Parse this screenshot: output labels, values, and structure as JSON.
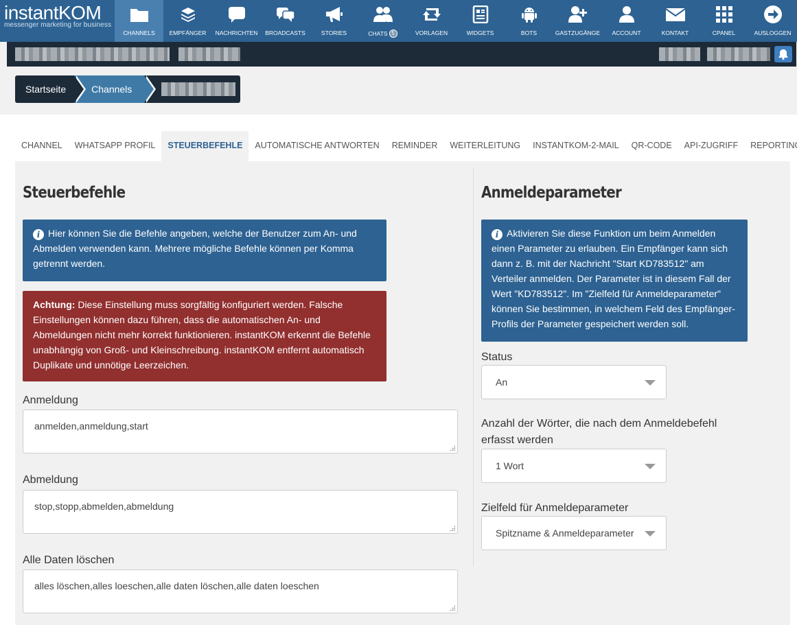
{
  "brand": {
    "name_left": "instant",
    "name_right": "KOM",
    "tagline": "messenger marketing for business"
  },
  "nav": [
    {
      "label": "CHANNELS",
      "icon": "folder-icon",
      "active": true
    },
    {
      "label": "EMPFÄNGER",
      "icon": "layers-icon"
    },
    {
      "label": "NACHRICHTEN",
      "icon": "speech-bubble-icon"
    },
    {
      "label": "BROADCASTS",
      "icon": "chat-bubbles-icon"
    },
    {
      "label": "STORIES",
      "icon": "megaphone-icon"
    },
    {
      "label": "CHATS",
      "icon": "users-icon",
      "badge": "5"
    },
    {
      "label": "VORLAGEN",
      "icon": "retweet-icon"
    },
    {
      "label": "WIDGETS",
      "icon": "newspaper-icon"
    },
    {
      "label": "BOTS",
      "icon": "android-icon"
    },
    {
      "label": "GASTZUGÄNGE",
      "icon": "user-plus-icon"
    },
    {
      "label": "ACCOUNT",
      "icon": "user-icon"
    },
    {
      "label": "KONTAKT",
      "icon": "envelope-icon"
    },
    {
      "label": "CPANEL",
      "icon": "grid-icon"
    },
    {
      "label": "AUSLOGGEN",
      "icon": "arrow-circle-right-icon"
    }
  ],
  "breadcrumb": {
    "home": "Startseite",
    "channels": "Channels"
  },
  "tabs": [
    "CHANNEL",
    "WHATSAPP PROFIL",
    "STEUERBEFEHLE",
    "AUTOMATISCHE ANTWORTEN",
    "REMINDER",
    "WEITERLEITUNG",
    "INSTANTKOM-2-MAIL",
    "QR-CODE",
    "API-ZUGRIFF",
    "REPORTING"
  ],
  "left": {
    "title": "Steuerbefehle",
    "info": "Hier können Sie die Befehle angeben, welche der Benutzer zum An- und Abmelden verwenden kann. Mehrere mögliche Befehle können per Komma getrennt werden.",
    "warning_label": "Achtung:",
    "warning": "Diese Einstellung muss sorgfältig konfiguriert werden. Falsche Einstellungen können dazu führen, dass die automatischen An- und Abmeldungen nicht mehr korrekt funktionieren. instantKOM erkennt die Befehle unabhängig von Groß- und Kleinschreibung. instantKOM entfernt automatisch Duplikate und unnötige Leerzeichen.",
    "fields": [
      {
        "label": "Anmeldung",
        "value": "anmelden,anmeldung,start"
      },
      {
        "label": "Abmeldung",
        "value": "stop,stopp,abmelden,abmeldung"
      },
      {
        "label": "Alle Daten löschen",
        "value": "alles löschen,alles loeschen,alle daten löschen,alle daten loeschen"
      }
    ]
  },
  "right": {
    "title": "Anmeldeparameter",
    "info": "Aktivieren Sie diese Funktion um beim Anmelden einen Parameter zu erlauben. Ein Empfänger kann sich dann z. B. mit der Nachricht \"Start KD783512\" am Verteiler anmelden. Der Parameter ist in diesem Fall der Wert \"KD783512\". Im \"Zielfeld für Anmeldeparameter\" können Sie bestimmen, in welchem Feld des Empfänger-Profils der Parameter gespeichert werden soll.",
    "selects": [
      {
        "label": "Status",
        "value": "An"
      },
      {
        "label": "Anzahl der Wörter, die nach dem Anmeldebefehl erfasst werden",
        "value": "1 Wort"
      },
      {
        "label": "Zielfeld für Anmeldeparameter",
        "value": "Spitzname & Anmeldeparameter"
      }
    ]
  }
}
